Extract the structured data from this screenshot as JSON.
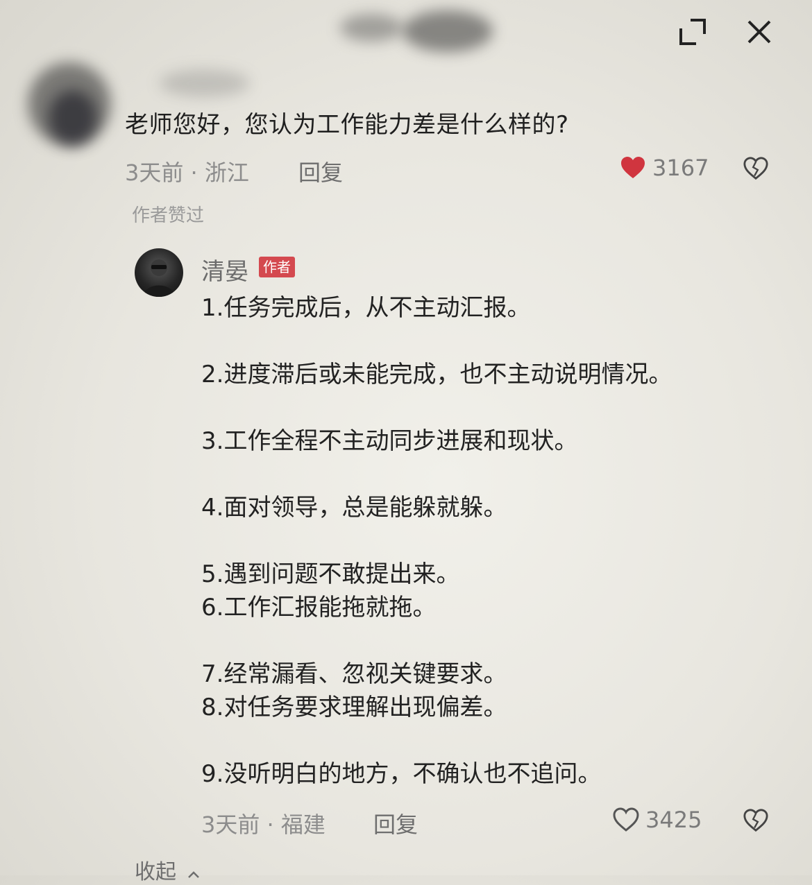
{
  "question": {
    "text": "老师您好，您认为工作能力差是什么样的?",
    "meta": "3天前 · 浙江",
    "reply_label": "回复",
    "like_count": "3167",
    "author_liked_label": "作者赞过"
  },
  "reply": {
    "author_name": "清晏",
    "author_badge": "作者",
    "body": "1.任务完成后，从不主动汇报。\n\n2.进度滞后或未能完成，也不主动说明情况。\n\n3.工作全程不主动同步进展和现状。\n\n4.面对领导，总是能躲就躲。\n\n5.遇到问题不敢提出来。\n6.工作汇报能拖就拖。\n\n7.经常漏看、忽视关键要求。\n8.对任务要求理解出现偏差。\n\n9.没听明白的地方，不确认也不追问。",
    "meta": "3天前 · 福建",
    "reply_label": "回复",
    "like_count": "3425"
  },
  "collapse_label": "收起",
  "icons": {
    "expand": "expand-icon",
    "close": "close-icon",
    "heart_filled": "heart-filled-icon",
    "heart_outline": "heart-outline-icon",
    "dislike": "broken-heart-icon",
    "chevron_up": "chevron-up-icon"
  },
  "colors": {
    "heart": "#d0353f",
    "badge": "#d4494f"
  }
}
